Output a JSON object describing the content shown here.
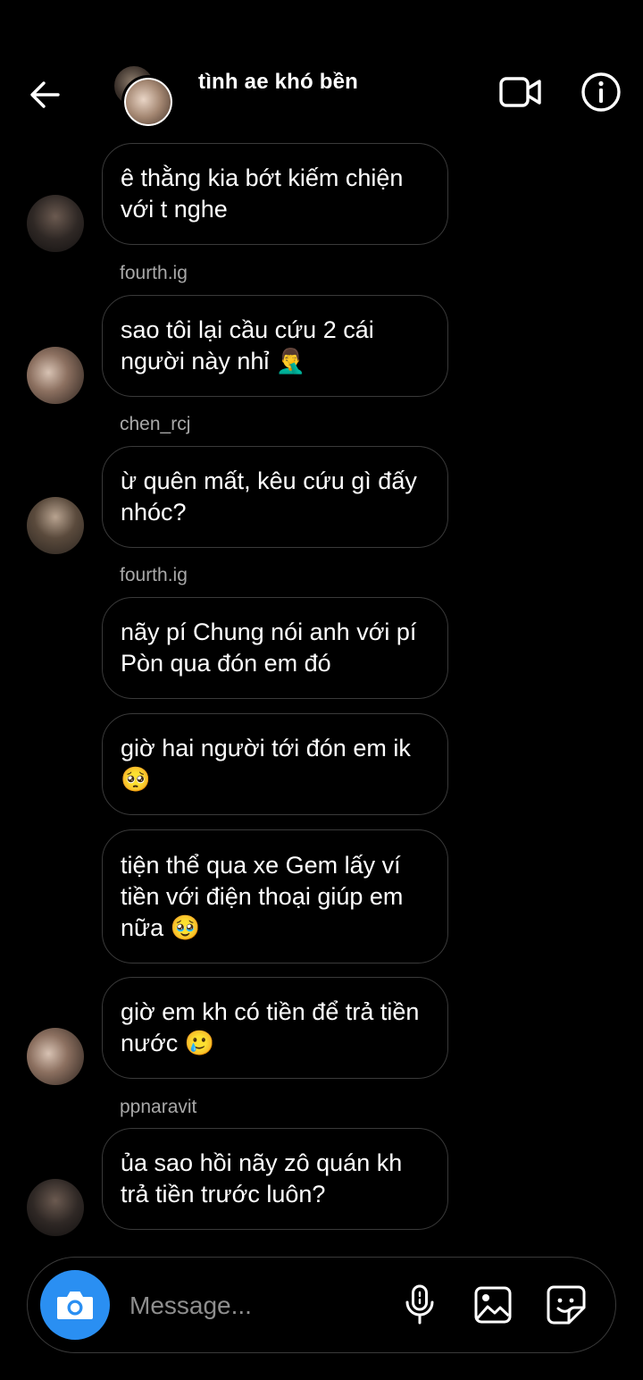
{
  "header": {
    "title": "tình ae khó bền"
  },
  "messages": [
    {
      "text": "ê thằng kia bớt kiếm chiện với t nghe"
    },
    {
      "sender": "fourth.ig",
      "text": "sao tôi lại cầu cứu 2 cái người này nhỉ 🤦‍♂️"
    },
    {
      "sender": "chen_rcj",
      "text": "ừ quên mất, kêu cứu gì đấy nhóc?"
    },
    {
      "sender": "fourth.ig",
      "text": "nãy pí Chung nói anh với pí Pòn qua đón em đó"
    },
    {
      "text": "giờ hai người tới đón em ik 🥺"
    },
    {
      "text": "tiện thể qua xe Gem lấy ví tiền với điện thoại giúp em nữa 🥹"
    },
    {
      "text": "giờ em kh có tiền để trả tiền nước 🥲"
    },
    {
      "sender": "ppnaravit",
      "text": "ủa sao hồi nãy zô quán kh trả tiền trước luôn?"
    }
  ],
  "composer": {
    "placeholder": "Message..."
  },
  "icons": {
    "back": "arrow-left-icon",
    "video": "video-camera-icon",
    "info": "info-icon",
    "camera": "camera-icon",
    "mic": "microphone-icon",
    "gallery": "image-icon",
    "sticker": "sticker-icon"
  },
  "colors": {
    "background": "#000000",
    "camera_button": "#2a8ff2",
    "bubble_border": "#3a3a3a",
    "sender_text": "#a8a8a8"
  }
}
